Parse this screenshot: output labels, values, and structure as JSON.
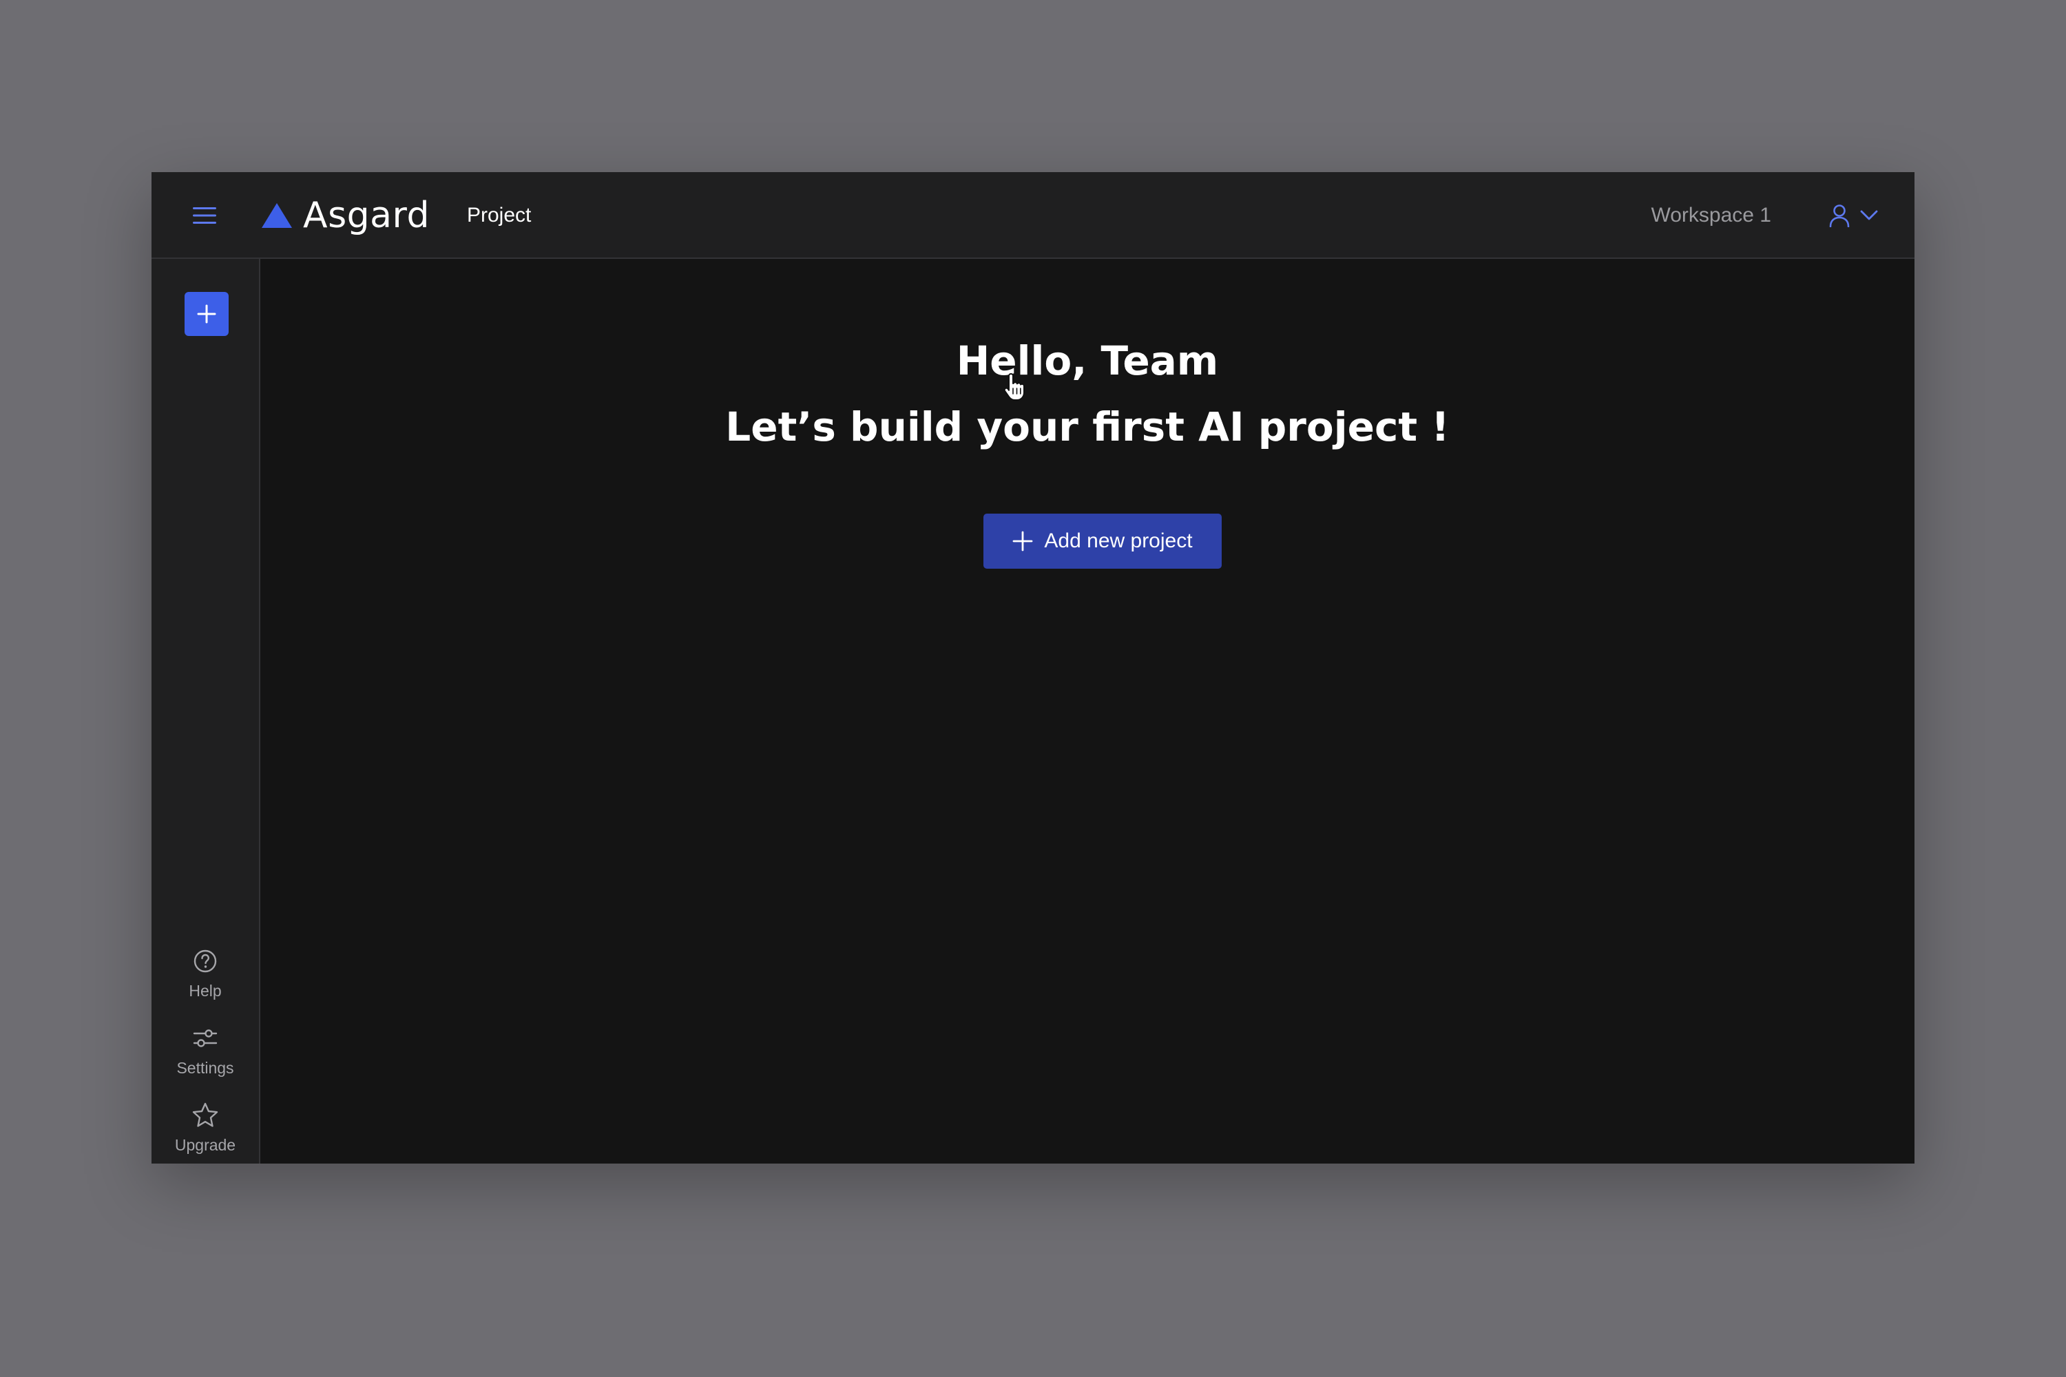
{
  "app": {
    "brand_name": "Asgard",
    "accent_color": "#3d5fe8",
    "button_color": "#2e41a8"
  },
  "header": {
    "menu_icon": "hamburger-menu-icon",
    "nav_item": "Project",
    "workspace_label": "Workspace 1",
    "user_icon": "user-icon",
    "dropdown_icon": "chevron-down-icon"
  },
  "sidebar": {
    "new_button_icon": "plus-icon",
    "items": [
      {
        "label": "Help",
        "icon": "question-circle-icon"
      },
      {
        "label": "Settings",
        "icon": "sliders-icon"
      },
      {
        "label": "Upgrade",
        "icon": "star-icon"
      }
    ]
  },
  "main": {
    "greeting_line1": "Hello, Team",
    "greeting_line2": "Let’s build your first AI project !",
    "cta_label": "Add new project",
    "cta_icon": "plus-icon"
  }
}
